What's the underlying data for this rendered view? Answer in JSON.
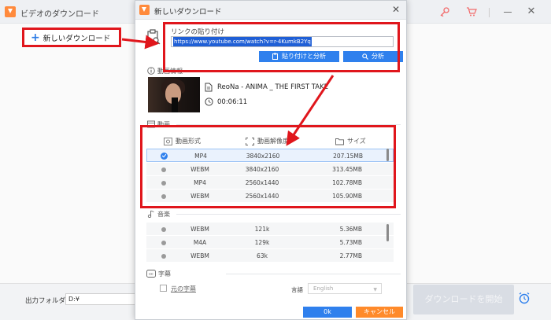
{
  "main_window": {
    "title": "ビデオのダウンロード",
    "new_download_label": "新しいダウンロード",
    "folder_label": "出力フォルダ：",
    "folder_value": "D:¥",
    "start_button_label": "ダウンロードを開始",
    "icons": [
      "app-logo-icon",
      "key-icon",
      "cart-icon",
      "minimize-icon",
      "close-icon",
      "alarm-clock-icon"
    ]
  },
  "dialog": {
    "title": "新しいダウンロード",
    "link_label": "リンクの貼り付け",
    "url_value": "https://www.youtube.com/watch?v=r-4KumkB2Yq",
    "paste_analyze_label": "貼り付けと分析",
    "analyze_label": "分析",
    "info_label": "動画情報",
    "video_title": "ReoNa - ANIMA _ THE FIRST TAKE",
    "duration": "00:06:11",
    "video_section_label": "動画",
    "audio_section_label": "音楽",
    "subtitle_section_label": "字幕",
    "video_table": {
      "headers": [
        "動画形式",
        "動画解像度",
        "サイズ"
      ],
      "rows": [
        {
          "format": "MP4",
          "resolution": "3840x2160",
          "size": "207.15MB",
          "selected": true
        },
        {
          "format": "WEBM",
          "resolution": "3840x2160",
          "size": "313.45MB",
          "selected": false
        },
        {
          "format": "MP4",
          "resolution": "2560x1440",
          "size": "102.78MB",
          "selected": false
        },
        {
          "format": "WEBM",
          "resolution": "2560x1440",
          "size": "105.90MB",
          "selected": false
        }
      ]
    },
    "audio_table": {
      "rows": [
        {
          "format": "WEBM",
          "bitrate": "121k",
          "size": "5.36MB"
        },
        {
          "format": "M4A",
          "bitrate": "129k",
          "size": "5.73MB"
        },
        {
          "format": "WEBM",
          "bitrate": "63k",
          "size": "2.77MB"
        }
      ]
    },
    "original_subtitle_label": "元の字幕",
    "language_label": "言語",
    "language_value": "English",
    "ok_label": "0k",
    "cancel_label": "キャンセル"
  },
  "colors": {
    "accent_blue": "#2f80ed",
    "accent_orange": "#ff8a2a",
    "annotation_red": "#e0161c"
  }
}
